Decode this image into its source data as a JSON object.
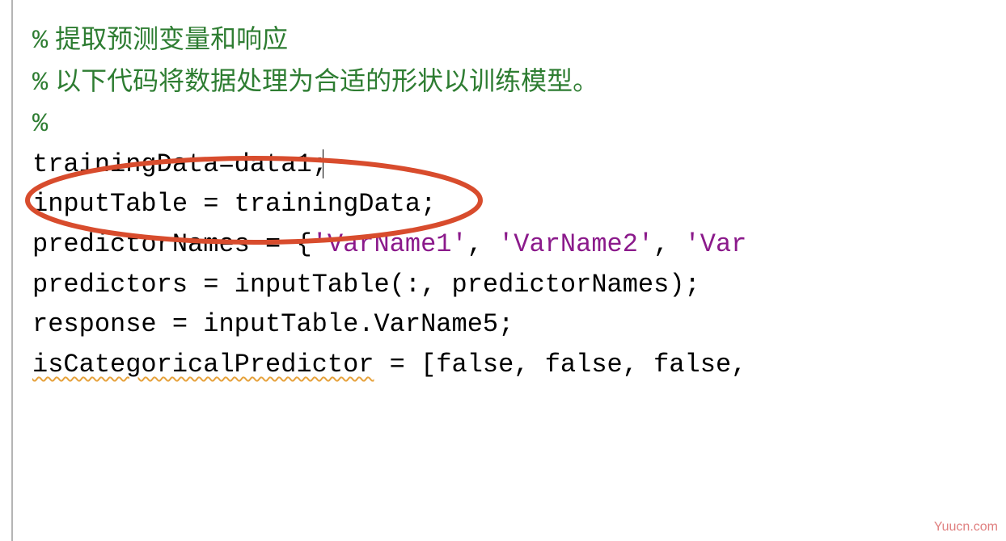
{
  "lines": {
    "comment1_pct": "%",
    "comment1_text": "提取预测变量和响应",
    "comment2_pct": "%",
    "comment2_text": "以下代码将数据处理为合适的形状以训练模型。",
    "comment3_pct": "%",
    "line4": "trainingData=data1;",
    "line5": "inputTable = trainingData;",
    "line6_part1": "predictorNames = {",
    "line6_str1": "'VarName1'",
    "line6_sep1": ", ",
    "line6_str2": "'VarName2'",
    "line6_sep2": ", ",
    "line6_str3": "'Var",
    "line7": "predictors = inputTable(:, predictorNames);",
    "line8": "response = inputTable.VarName5;",
    "line9_wavy": "isCategoricalPredictor",
    "line9_rest": " = [false, false, false,"
  },
  "watermark": "Yuucn.com"
}
